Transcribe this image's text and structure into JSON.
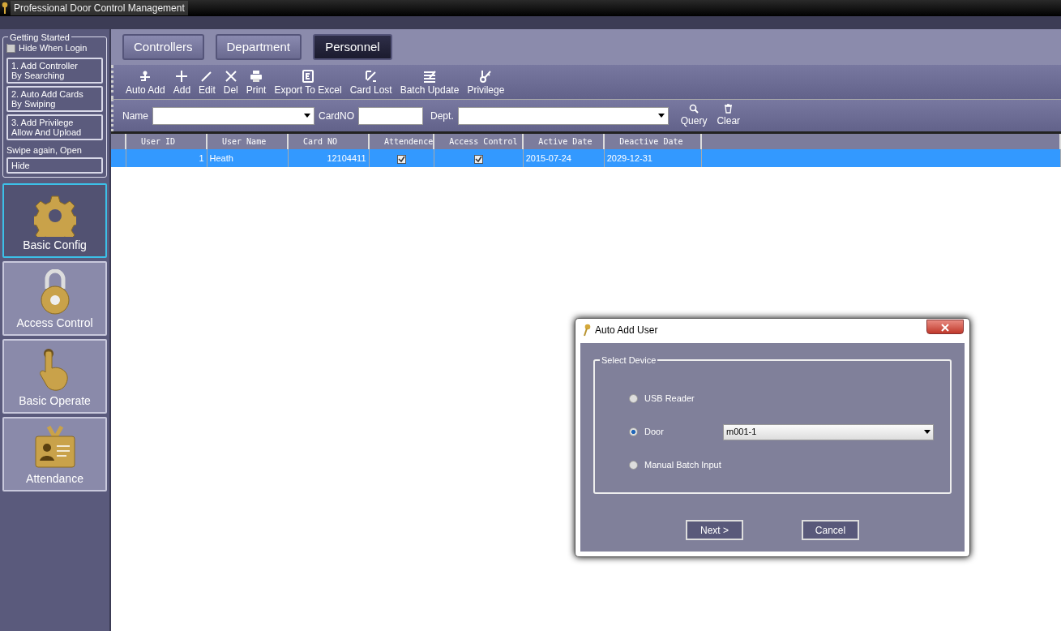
{
  "window": {
    "title": "Professional Door Control Management"
  },
  "getting_started": {
    "title": "Getting Started",
    "hide_when_login": {
      "label": "Hide When Login",
      "checked": false
    },
    "steps": [
      {
        "line1": "1. Add Controller",
        "line2": "By Searching"
      },
      {
        "line1": "2. Auto Add Cards",
        "line2": "By Swiping"
      },
      {
        "line1": "3. Add Privilege",
        "line2": "Allow And Upload"
      }
    ],
    "note": "Swipe again, Open",
    "hide_button": "Hide"
  },
  "modules": [
    {
      "label": "Basic Config",
      "kind": "gear",
      "selected": true
    },
    {
      "label": "Access Control",
      "kind": "lock",
      "selected": false
    },
    {
      "label": "Basic Operate",
      "kind": "hand",
      "selected": false
    },
    {
      "label": "Attendance",
      "kind": "badge",
      "selected": false
    }
  ],
  "tabs": [
    {
      "label": "Controllers",
      "selected": false
    },
    {
      "label": "Department",
      "selected": false
    },
    {
      "label": "Personnel",
      "selected": true
    }
  ],
  "toolbar": [
    {
      "label": "Auto Add",
      "kind": "autoadd"
    },
    {
      "label": "Add",
      "kind": "add"
    },
    {
      "label": "Edit",
      "kind": "edit"
    },
    {
      "label": "Del",
      "kind": "del"
    },
    {
      "label": "Print",
      "kind": "print"
    },
    {
      "label": "Export To Excel",
      "kind": "excel"
    },
    {
      "label": "Card Lost",
      "kind": "lost"
    },
    {
      "label": "Batch Update",
      "kind": "batch"
    },
    {
      "label": "Privilege",
      "kind": "privilege"
    }
  ],
  "filters": {
    "name_label": "Name",
    "cardno_label": "CardNO",
    "dept_label": "Dept.",
    "query": "Query",
    "clear": "Clear"
  },
  "table": {
    "columns": [
      "User ID",
      "User Name",
      "Card NO",
      "Attendence",
      "Access Control",
      "Active Date",
      "Deactive Date"
    ],
    "rows": [
      {
        "selected": true,
        "user_id": "1",
        "user_name": "Heath",
        "card_no": "12104411",
        "attendance": true,
        "access_control": true,
        "active_date": "2015-07-24",
        "deactive_date": "2029-12-31"
      }
    ]
  },
  "dialog": {
    "title": "Auto Add User",
    "group": "Select Device",
    "options": [
      {
        "label": "USB Reader",
        "selected": false
      },
      {
        "label": "Door",
        "selected": true,
        "select_value": "m001-1"
      },
      {
        "label": "Manual Batch Input",
        "selected": false
      }
    ],
    "buttons": [
      "Next >",
      "Cancel"
    ]
  }
}
